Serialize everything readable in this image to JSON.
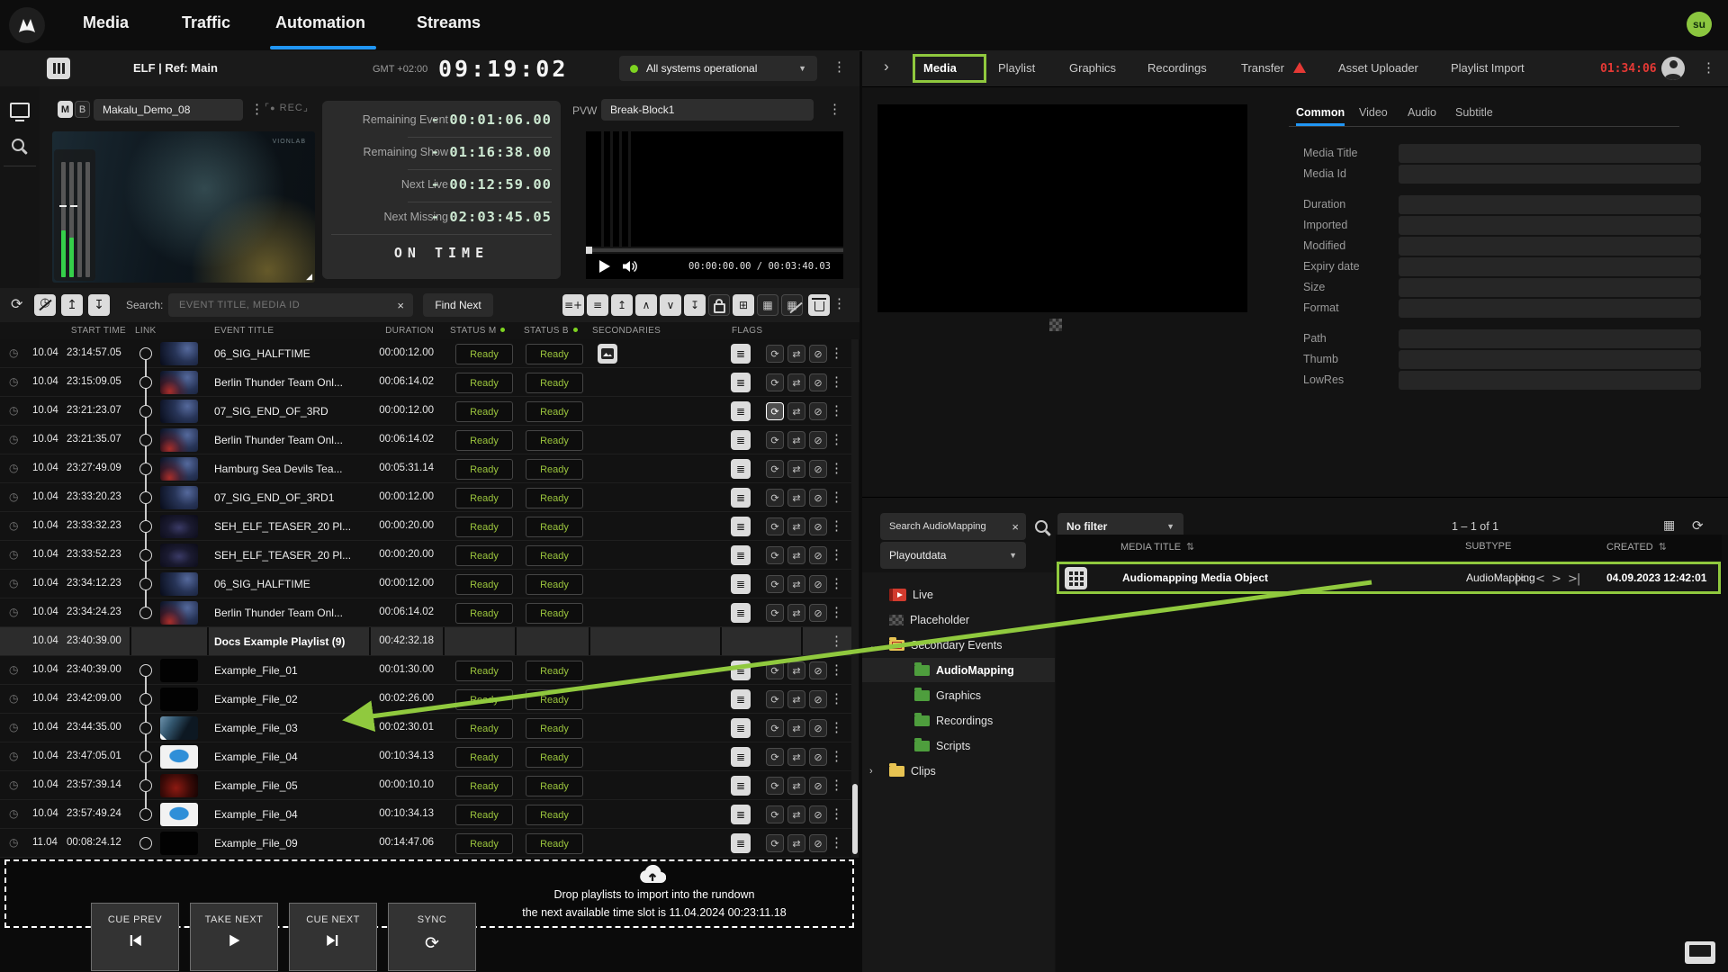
{
  "topnav": {
    "tabs": [
      "Media",
      "Traffic",
      "Automation",
      "Streams"
    ],
    "active_tab": "Automation",
    "avatar_label": "su"
  },
  "auto_header": {
    "title": "ELF | Ref: Main",
    "timezone": "GMT +02:00",
    "clock": "09:19:02",
    "status_label": "All systems operational"
  },
  "pgm": {
    "mode_m": "M",
    "mode_b": "B",
    "channel_name": "Makalu_Demo_08",
    "rec_label": "REC",
    "watermark": "VIONLAB"
  },
  "counters": {
    "rows": [
      {
        "label": "Remaining Event",
        "value": "- 00:01:06.00"
      },
      {
        "label": "Remaining Show",
        "value": "- 01:16:38.00"
      },
      {
        "label": "Next Live",
        "value": "- 00:12:59.00"
      },
      {
        "label": "Next Missing",
        "value": "- 02:03:45.05"
      }
    ],
    "status": "ON TIME"
  },
  "pvw": {
    "label": "PVW",
    "channel_name": "Break-Block1",
    "timecode": "00:00:00.00 / 00:03:40.03"
  },
  "rundown_toolbar": {
    "search_label": "Search:",
    "search_placeholder": "EVENT TITLE, MEDIA ID",
    "find_next_label": "Find Next"
  },
  "rundown": {
    "columns": [
      "START TIME",
      "LINK",
      "EVENT TITLE",
      "DURATION",
      "STATUS M",
      "STATUS B",
      "SECONDARIES",
      "FLAGS"
    ],
    "rows": [
      {
        "date": "10.04",
        "time": "23:14:57.05",
        "title": "06_SIG_HALFTIME",
        "duration": "00:00:12.00",
        "status_m": "Ready",
        "status_b": "Ready",
        "type": "event",
        "thumb": "planet",
        "secondaries": true,
        "loop_active": false,
        "chain": "start"
      },
      {
        "date": "10.04",
        "time": "23:15:09.05",
        "title": "Berlin Thunder Team Onl...",
        "duration": "00:06:14.02",
        "status_m": "Ready",
        "status_b": "Ready",
        "type": "event",
        "thumb": "planet-red",
        "secondaries": false,
        "loop_active": false,
        "chain": "mid"
      },
      {
        "date": "10.04",
        "time": "23:21:23.07",
        "title": "07_SIG_END_OF_3RD",
        "duration": "00:00:12.00",
        "status_m": "Ready",
        "status_b": "Ready",
        "type": "event",
        "thumb": "planet",
        "secondaries": false,
        "loop_active": true,
        "chain": "mid"
      },
      {
        "date": "10.04",
        "time": "23:21:35.07",
        "title": "Berlin Thunder Team Onl...",
        "duration": "00:06:14.02",
        "status_m": "Ready",
        "status_b": "Ready",
        "type": "event",
        "thumb": "planet-red",
        "secondaries": false,
        "loop_active": false,
        "chain": "mid"
      },
      {
        "date": "10.04",
        "time": "23:27:49.09",
        "title": "Hamburg Sea Devils Tea...",
        "duration": "00:05:31.14",
        "status_m": "Ready",
        "status_b": "Ready",
        "type": "event",
        "thumb": "planet-red",
        "secondaries": false,
        "loop_active": false,
        "chain": "mid"
      },
      {
        "date": "10.04",
        "time": "23:33:20.23",
        "title": "07_SIG_END_OF_3RD1",
        "duration": "00:00:12.00",
        "status_m": "Ready",
        "status_b": "Ready",
        "type": "event",
        "thumb": "planet",
        "secondaries": false,
        "loop_active": false,
        "chain": "mid"
      },
      {
        "date": "10.04",
        "time": "23:33:32.23",
        "title": "SEH_ELF_TEASER_20 Pl...",
        "duration": "00:00:20.00",
        "status_m": "Ready",
        "status_b": "Ready",
        "type": "event",
        "thumb": "teaser",
        "secondaries": false,
        "loop_active": false,
        "chain": "mid"
      },
      {
        "date": "10.04",
        "time": "23:33:52.23",
        "title": "SEH_ELF_TEASER_20 Pl...",
        "duration": "00:00:20.00",
        "status_m": "Ready",
        "status_b": "Ready",
        "type": "event",
        "thumb": "teaser",
        "secondaries": false,
        "loop_active": false,
        "chain": "mid"
      },
      {
        "date": "10.04",
        "time": "23:34:12.23",
        "title": "06_SIG_HALFTIME",
        "duration": "00:00:12.00",
        "status_m": "Ready",
        "status_b": "Ready",
        "type": "event",
        "thumb": "planet",
        "secondaries": false,
        "loop_active": false,
        "chain": "mid"
      },
      {
        "date": "10.04",
        "time": "23:34:24.23",
        "title": "Berlin Thunder Team Onl...",
        "duration": "00:06:14.02",
        "status_m": "Ready",
        "status_b": "Ready",
        "type": "event",
        "thumb": "planet-red",
        "secondaries": false,
        "loop_active": false,
        "chain": "end"
      },
      {
        "date": "10.04",
        "time": "23:40:39.00",
        "title": "Docs Example Playlist (9)",
        "duration": "00:42:32.18",
        "type": "group"
      },
      {
        "date": "10.04",
        "time": "23:40:39.00",
        "title": "Example_File_01",
        "duration": "00:01:30.00",
        "status_m": "Ready",
        "status_b": "Ready",
        "type": "event",
        "thumb": "black",
        "secondaries": false,
        "loop_active": false,
        "chain": "start"
      },
      {
        "date": "10.04",
        "time": "23:42:09.00",
        "title": "Example_File_02",
        "duration": "00:02:26.00",
        "status_m": "Ready",
        "status_b": "Ready",
        "type": "event",
        "thumb": "black",
        "secondaries": false,
        "loop_active": false,
        "chain": "mid"
      },
      {
        "date": "10.04",
        "time": "23:44:35.00",
        "title": "Example_File_03",
        "duration": "00:02:30.01",
        "status_m": "Ready",
        "status_b": "Ready",
        "type": "event",
        "thumb": "ocean",
        "secondaries": false,
        "loop_active": false,
        "chain": "mid"
      },
      {
        "date": "10.04",
        "time": "23:47:05.01",
        "title": "Example_File_04",
        "duration": "00:10:34.13",
        "status_m": "Ready",
        "status_b": "Ready",
        "type": "event",
        "thumb": "bunny",
        "secondaries": false,
        "loop_active": false,
        "chain": "mid"
      },
      {
        "date": "10.04",
        "time": "23:57:39.14",
        "title": "Example_File_05",
        "duration": "00:00:10.10",
        "status_m": "Ready",
        "status_b": "Ready",
        "type": "event",
        "thumb": "ember",
        "secondaries": false,
        "loop_active": false,
        "chain": "mid"
      },
      {
        "date": "10.04",
        "time": "23:57:49.24",
        "title": "Example_File_04",
        "duration": "00:10:34.13",
        "status_m": "Ready",
        "status_b": "Ready",
        "type": "event",
        "thumb": "bunny",
        "secondaries": false,
        "loop_active": false,
        "chain": "end"
      },
      {
        "date": "11.04",
        "time": "00:08:24.12",
        "title": "Example_File_09",
        "duration": "00:14:47.06",
        "status_m": "Ready",
        "status_b": "Ready",
        "type": "event",
        "thumb": "black",
        "secondaries": false,
        "loop_active": false,
        "chain": "none"
      }
    ]
  },
  "dropzone": {
    "line1": "Drop playlists to import into the rundown",
    "line2": "the next available time slot is 11.04.2024 00:23:11.18"
  },
  "transport": {
    "buttons": [
      "CUE PREV",
      "TAKE NEXT",
      "CUE NEXT",
      "SYNC"
    ]
  },
  "media_panel": {
    "tabs": [
      "Media",
      "Playlist",
      "Graphics",
      "Recordings",
      "Transfer",
      "Asset Uploader",
      "Playlist Import"
    ],
    "active_tab": "Media",
    "transfer_has_warning": true,
    "timer": "01:34:06",
    "details_tabs": [
      "Common",
      "Video",
      "Audio",
      "Subtitle"
    ],
    "active_details_tab": "Common",
    "fields": [
      "Media Title",
      "Media Id",
      "Duration",
      "Imported",
      "Modified",
      "Expiry date",
      "Size",
      "Format",
      "Path",
      "Thumb",
      "LowRes"
    ],
    "browser": {
      "search_value": "Search AudioMapping",
      "filter_value": "No filter",
      "pagination": "1 – 1 of 1",
      "root_select": "Playoutdata",
      "tree": [
        {
          "label": "Live",
          "icon": "live",
          "level": 0,
          "state": "none"
        },
        {
          "label": "Placeholder",
          "icon": "placeholder",
          "level": 0,
          "state": "none"
        },
        {
          "label": "Secondary Events",
          "icon": "folder-yellow-se",
          "level": 0,
          "state": "expanded"
        },
        {
          "label": "AudioMapping",
          "icon": "folder-green",
          "level": 1,
          "state": "selected"
        },
        {
          "label": "Graphics",
          "icon": "folder-green",
          "level": 1,
          "state": "none"
        },
        {
          "label": "Recordings",
          "icon": "folder-green",
          "level": 1,
          "state": "none"
        },
        {
          "label": "Scripts",
          "icon": "folder-green",
          "level": 1,
          "state": "none"
        },
        {
          "label": "Clips",
          "icon": "folder-yellow",
          "level": 0,
          "state": "collapsed"
        }
      ],
      "table": {
        "columns": [
          "MEDIA TITLE",
          "SUBTYPE",
          "CREATED"
        ],
        "rows": [
          {
            "title": "Audiomapping Media Object",
            "subtype": "AudioMapping",
            "created": "04.09.2023 12:42:01"
          }
        ]
      }
    }
  },
  "colors": {
    "accent_green": "#90c93e",
    "accent_blue": "#2196f3",
    "ready_green": "#9bc53d",
    "alert_red": "#e53935"
  }
}
